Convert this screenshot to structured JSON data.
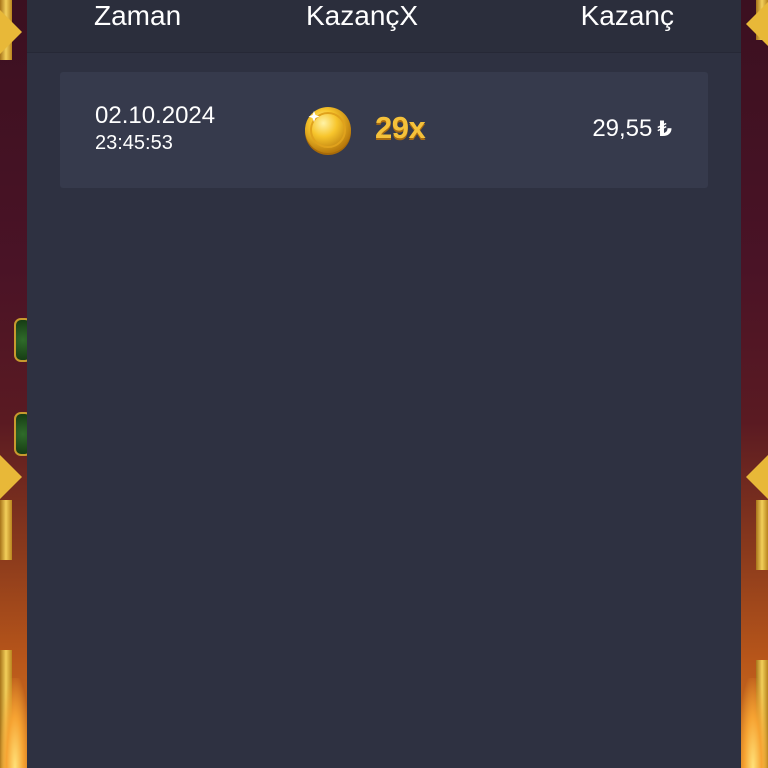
{
  "table": {
    "headers": {
      "time": "Zaman",
      "multiplier": "KazançX",
      "win": "Kazanç"
    },
    "rows": [
      {
        "date": "02.10.2024",
        "time": "23:45:53",
        "icon": "gold-coin-icon",
        "multiplier": "29x",
        "amount": "29,55",
        "currency": "₺"
      }
    ]
  },
  "colors": {
    "panel": "#2e3141",
    "header": "#2b2e3c",
    "row": "#363a4c",
    "multiplier": "#f5c13a",
    "text": "#ffffff"
  }
}
